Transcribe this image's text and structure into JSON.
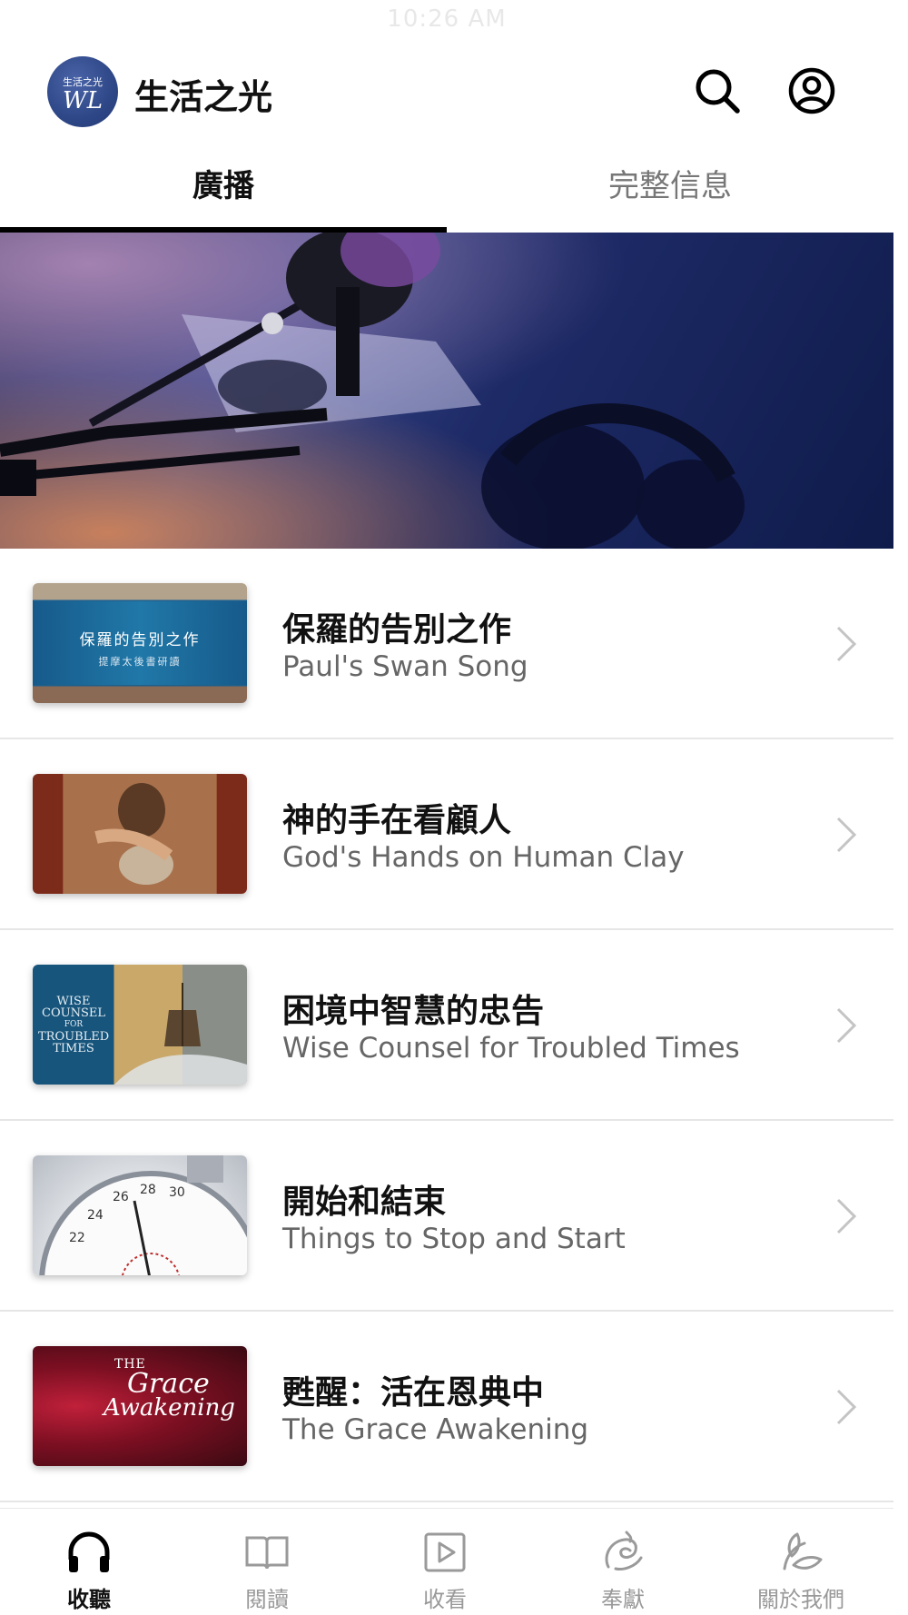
{
  "status_bar": {
    "time": "10:26 AM"
  },
  "header": {
    "app_title": "生活之光",
    "logo_text_top": "生活之光",
    "logo_monogram": "WL",
    "search_icon": "search-icon",
    "account_icon": "account-icon"
  },
  "tabs": [
    {
      "label": "廣播",
      "active": true
    },
    {
      "label": "完整信息",
      "active": false
    }
  ],
  "hero": {
    "image": "podcast-microphone-headphones"
  },
  "programs": [
    {
      "title": "保羅的告別之作",
      "subtitle": "Paul's Swan Song",
      "thumb_title": "保羅的告別之作",
      "thumb_sub": "提摩太後書研讀"
    },
    {
      "title": "神的手在看顧人",
      "subtitle": "God's Hands on Human Clay"
    },
    {
      "title": "困境中智慧的忠告",
      "subtitle": "Wise Counsel for Troubled Times",
      "thumb_text": [
        "WISE",
        "COUNSEL",
        "FOR",
        "TROUBLED",
        "TIMES"
      ]
    },
    {
      "title": "開始和結束",
      "subtitle": "Things to Stop and Start"
    },
    {
      "title": "甦醒：活在恩典中",
      "subtitle": "The Grace Awakening",
      "thumb_text": [
        "THE",
        "Grace",
        "Awakening"
      ]
    }
  ],
  "bottom_nav": [
    {
      "label": "收聽",
      "icon": "headphones-icon",
      "active": true
    },
    {
      "label": "閱讀",
      "icon": "book-icon",
      "active": false
    },
    {
      "label": "收看",
      "icon": "play-icon",
      "active": false
    },
    {
      "label": "奉獻",
      "icon": "offering-icon",
      "active": false
    },
    {
      "label": "關於我們",
      "icon": "leaf-icon",
      "active": false
    }
  ],
  "colors": {
    "accent": "#111111",
    "inactive": "#999999",
    "logo_blue": "#2e4787"
  }
}
